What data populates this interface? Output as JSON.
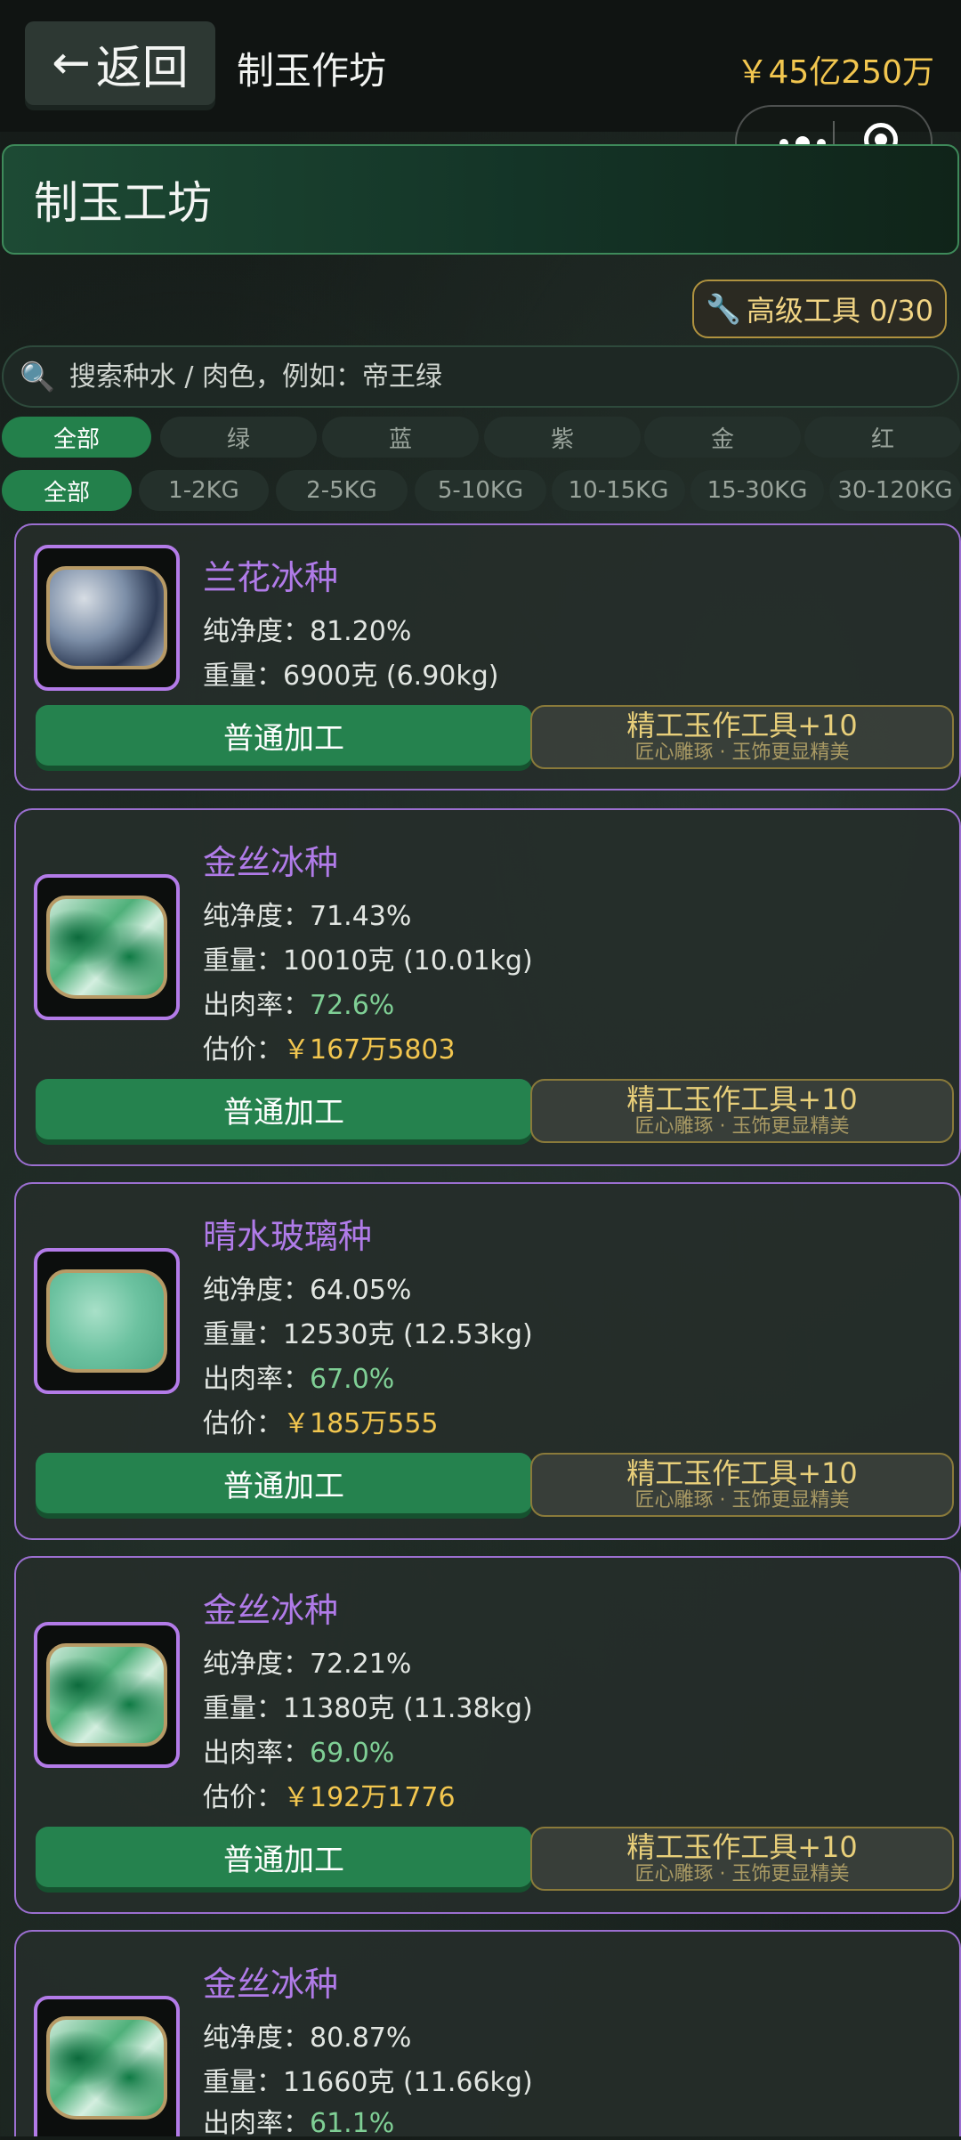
{
  "header": {
    "back_label": "返回",
    "title": "制玉作坊",
    "money": "￥45亿250万"
  },
  "banner": {
    "title": "制玉工坊"
  },
  "tool": {
    "label": "高级工具 0/30"
  },
  "search": {
    "placeholder": "搜索种水 / 肉色，例如：帝王绿"
  },
  "color_filters": [
    "全部",
    "绿",
    "蓝",
    "紫",
    "金",
    "红"
  ],
  "weight_filters": [
    "全部",
    "1-2KG",
    "2-5KG",
    "5-10KG",
    "10-15KG",
    "15-30KG",
    "30-120KG"
  ],
  "labels": {
    "purity": "纯净度：",
    "weight": "重量：",
    "yield": "出肉率：",
    "estimate": "估价：",
    "normal_btn": "普通加工",
    "fine_btn": "精工玉作工具+10",
    "fine_sub": "匠心雕琢 · 玉饰更显精美"
  },
  "items": [
    {
      "name": "兰花冰种",
      "purity": "81.20%",
      "weight": "6900克 (6.90kg)",
      "yield": "",
      "estimate": "",
      "jade": "lan"
    },
    {
      "name": "金丝冰种",
      "purity": "71.43%",
      "weight": "10010克 (10.01kg)",
      "yield": "72.6%",
      "estimate": "￥167万5803",
      "jade": "jin"
    },
    {
      "name": "晴水玻璃种",
      "purity": "64.05%",
      "weight": "12530克 (12.53kg)",
      "yield": "67.0%",
      "estimate": "￥185万555",
      "jade": "qing"
    },
    {
      "name": "金丝冰种",
      "purity": "72.21%",
      "weight": "11380克 (11.38kg)",
      "yield": "69.0%",
      "estimate": "￥192万1776",
      "jade": "jin"
    },
    {
      "name": "金丝冰种",
      "purity": "80.87%",
      "weight": "11660克 (11.66kg)",
      "yield": "61.1%",
      "estimate": "",
      "jade": "jin"
    }
  ]
}
